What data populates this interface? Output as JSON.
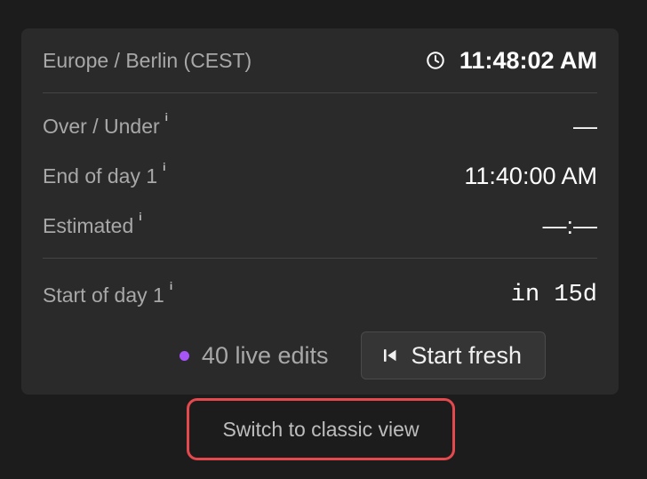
{
  "timezone": {
    "label": "Europe / Berlin (CEST)",
    "icon": "clock-icon",
    "current_time": "11:48:02 AM"
  },
  "rows": {
    "over_under": {
      "label": "Over / Under",
      "info": "i",
      "value": "—"
    },
    "end_of_day": {
      "label": "End of day 1",
      "info": "i",
      "value": "11:40:00 AM"
    },
    "estimated": {
      "label": "Estimated",
      "info": "i",
      "value": "—:—"
    },
    "start_of_day": {
      "label": "Start of day 1",
      "info": "i",
      "value": "in 15d"
    }
  },
  "live_edits": {
    "text": "40 live edits",
    "dot_color": "#a855f7"
  },
  "start_fresh": {
    "label": "Start fresh",
    "icon": "skip-back-icon"
  },
  "switch_view": {
    "label": "Switch to classic view",
    "highlight_color": "#e5484d"
  }
}
